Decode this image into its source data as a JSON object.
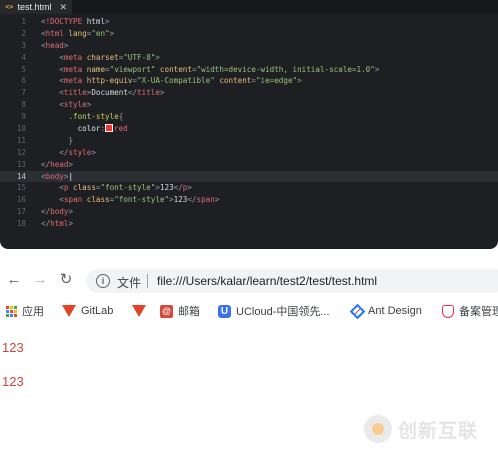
{
  "editor": {
    "tab": {
      "icon": "<>",
      "label": "test.html",
      "close": "✕"
    },
    "lines": [
      {
        "n": "1",
        "tokens": [
          [
            "punc",
            "<"
          ],
          [
            "doctype",
            "!DOCTYPE"
          ],
          [
            "text",
            " html"
          ],
          [
            "punc",
            ">"
          ]
        ]
      },
      {
        "n": "2",
        "tokens": [
          [
            "punc",
            "<"
          ],
          [
            "tag",
            "html"
          ],
          [
            "text",
            " "
          ],
          [
            "attr",
            "lang"
          ],
          [
            "punc",
            "="
          ],
          [
            "str",
            "\"en\""
          ],
          [
            "punc",
            ">"
          ]
        ]
      },
      {
        "n": "3",
        "tokens": [
          [
            "punc",
            "<"
          ],
          [
            "tag",
            "head"
          ],
          [
            "punc",
            ">"
          ]
        ]
      },
      {
        "n": "4",
        "tokens": [
          [
            "text",
            "    "
          ],
          [
            "punc",
            "<"
          ],
          [
            "tag",
            "meta"
          ],
          [
            "text",
            " "
          ],
          [
            "attr",
            "charset"
          ],
          [
            "punc",
            "="
          ],
          [
            "str",
            "\"UTF-8\""
          ],
          [
            "punc",
            ">"
          ]
        ]
      },
      {
        "n": "5",
        "tokens": [
          [
            "text",
            "    "
          ],
          [
            "punc",
            "<"
          ],
          [
            "tag",
            "meta"
          ],
          [
            "text",
            " "
          ],
          [
            "attr",
            "name"
          ],
          [
            "punc",
            "="
          ],
          [
            "str",
            "\"viewport\""
          ],
          [
            "text",
            " "
          ],
          [
            "attr",
            "content"
          ],
          [
            "punc",
            "="
          ],
          [
            "str",
            "\"width=device-width, initial-scale=1.0\""
          ],
          [
            "punc",
            ">"
          ]
        ]
      },
      {
        "n": "6",
        "tokens": [
          [
            "text",
            "    "
          ],
          [
            "punc",
            "<"
          ],
          [
            "tag",
            "meta"
          ],
          [
            "text",
            " "
          ],
          [
            "attr",
            "http-equiv"
          ],
          [
            "punc",
            "="
          ],
          [
            "str",
            "\"X-UA-Compatible\""
          ],
          [
            "text",
            " "
          ],
          [
            "attr",
            "content"
          ],
          [
            "punc",
            "="
          ],
          [
            "str",
            "\"ie=edge\""
          ],
          [
            "punc",
            ">"
          ]
        ]
      },
      {
        "n": "7",
        "tokens": [
          [
            "text",
            "    "
          ],
          [
            "punc",
            "<"
          ],
          [
            "tag",
            "title"
          ],
          [
            "punc",
            ">"
          ],
          [
            "text",
            "Document"
          ],
          [
            "punc",
            "</"
          ],
          [
            "tag",
            "title"
          ],
          [
            "punc",
            ">"
          ]
        ]
      },
      {
        "n": "8",
        "tokens": [
          [
            "text",
            "    "
          ],
          [
            "punc",
            "<"
          ],
          [
            "tag",
            "style"
          ],
          [
            "punc",
            ">"
          ]
        ]
      },
      {
        "n": "9",
        "tokens": [
          [
            "text",
            "      "
          ],
          [
            "sel",
            ".font-style"
          ],
          [
            "punc",
            "{"
          ]
        ]
      },
      {
        "n": "10",
        "tokens": [
          [
            "text",
            "        "
          ],
          [
            "prop",
            "color"
          ],
          [
            "punc",
            ":"
          ],
          [
            "swatch",
            ""
          ],
          [
            "red",
            "red"
          ]
        ]
      },
      {
        "n": "11",
        "tokens": [
          [
            "text",
            "      "
          ],
          [
            "punc",
            "}"
          ]
        ]
      },
      {
        "n": "12",
        "tokens": [
          [
            "text",
            "    "
          ],
          [
            "punc",
            "</"
          ],
          [
            "tag",
            "style"
          ],
          [
            "punc",
            ">"
          ]
        ]
      },
      {
        "n": "13",
        "tokens": [
          [
            "punc",
            "</"
          ],
          [
            "tag",
            "head"
          ],
          [
            "punc",
            ">"
          ]
        ]
      },
      {
        "n": "14",
        "active": true,
        "tokens": [
          [
            "punc",
            "<"
          ],
          [
            "tag",
            "body"
          ],
          [
            "punc",
            ">"
          ],
          [
            "caret",
            "|"
          ]
        ]
      },
      {
        "n": "15",
        "tokens": [
          [
            "text",
            "    "
          ],
          [
            "punc",
            "<"
          ],
          [
            "tag",
            "p"
          ],
          [
            "text",
            " "
          ],
          [
            "attr",
            "class"
          ],
          [
            "punc",
            "="
          ],
          [
            "str",
            "\"font-style\""
          ],
          [
            "punc",
            ">"
          ],
          [
            "text",
            "123"
          ],
          [
            "punc",
            "</"
          ],
          [
            "tag",
            "p"
          ],
          [
            "punc",
            ">"
          ]
        ]
      },
      {
        "n": "16",
        "tokens": [
          [
            "text",
            "    "
          ],
          [
            "punc",
            "<"
          ],
          [
            "tag",
            "span"
          ],
          [
            "text",
            " "
          ],
          [
            "attr",
            "class"
          ],
          [
            "punc",
            "="
          ],
          [
            "str",
            "\"font-style\""
          ],
          [
            "punc",
            ">"
          ],
          [
            "text",
            "123"
          ],
          [
            "punc",
            "</"
          ],
          [
            "tag",
            "span"
          ],
          [
            "punc",
            ">"
          ]
        ]
      },
      {
        "n": "17",
        "tokens": [
          [
            "punc",
            "</"
          ],
          [
            "tag",
            "body"
          ],
          [
            "punc",
            ">"
          ]
        ]
      },
      {
        "n": "18",
        "tokens": [
          [
            "punc",
            "</"
          ],
          [
            "tag",
            "html"
          ],
          [
            "punc",
            ">"
          ]
        ]
      }
    ]
  },
  "browser": {
    "nav": {
      "back": "←",
      "forward": "→",
      "reload": "↻"
    },
    "omnibox": {
      "info": "i",
      "scheme_label": "文件",
      "url": "file:///Users/kalar/learn/test2/test/test.html"
    },
    "bookmarks": [
      {
        "icon": "apps-grid-icon",
        "label": "应用"
      },
      {
        "icon": "gitlab-icon",
        "label": "GitLab"
      },
      {
        "icon": "gitlab-icon",
        "label": ""
      },
      {
        "icon": "mail-icon",
        "label": "邮箱"
      },
      {
        "icon": "ucloud-icon",
        "label": "UCloud-中国领先..."
      },
      {
        "icon": "ant-design-icon",
        "label": "Ant Design"
      },
      {
        "icon": "shield-icon",
        "label": "备案管理"
      }
    ],
    "output": {
      "line1": "123",
      "line2": "123"
    },
    "watermark": {
      "text": "创新互联"
    }
  },
  "colors": {
    "output_red": "#d0453b",
    "editor_bg": "#1e1f22",
    "swatch": "#ff2e2e"
  }
}
